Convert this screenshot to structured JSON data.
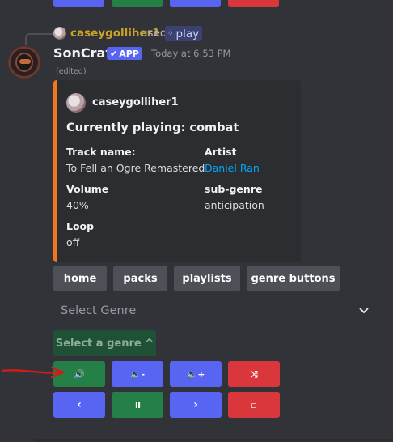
{
  "reply": {
    "user": "caseygolliher1",
    "used": "used",
    "command": "play"
  },
  "message": {
    "username": "SonCraft",
    "badge": "APP",
    "timestamp": "Today at 6:53 PM",
    "edited": "(edited)"
  },
  "embed": {
    "accent_color": "#f0761f",
    "author": "caseygolliher1",
    "title": "Currently playing: combat",
    "fields": [
      {
        "name": "Track name:",
        "value": "To Fell an Ogre Remastered"
      },
      {
        "name": "Artist",
        "value": "Daniel Ran"
      },
      {
        "name": "Volume",
        "value": "40%"
      },
      {
        "name": "sub-genre",
        "value": "anticipation"
      },
      {
        "name": "Loop",
        "value": "off"
      }
    ]
  },
  "nav_buttons": {
    "home": "home",
    "packs": "packs",
    "playlists": "playlists",
    "genre_buttons": "genre buttons"
  },
  "select": {
    "placeholder": "Select Genre"
  },
  "genre_button": "Select a genre ^",
  "controls": {
    "row1": [
      {
        "icon": "🔊",
        "name": "volume-icon"
      },
      {
        "icon": "🔈-",
        "name": "volume-down-icon"
      },
      {
        "icon": "🔈+",
        "name": "volume-up-icon"
      },
      {
        "icon": "⤨",
        "name": "shuffle-icon"
      }
    ],
    "row2": [
      {
        "icon": "‹",
        "name": "previous-icon"
      },
      {
        "icon": "II",
        "name": "pause-icon"
      },
      {
        "icon": "›",
        "name": "next-icon"
      },
      {
        "icon": "▫",
        "name": "stop-icon"
      }
    ]
  },
  "colors": {
    "background": "#313338",
    "embed_bg": "#2b2d31",
    "blurple": "#5865f2",
    "green": "#248046",
    "red": "#da373c",
    "grey": "#4e5058",
    "link": "#00a8fc",
    "annotation_arrow": "#d11a1a"
  }
}
